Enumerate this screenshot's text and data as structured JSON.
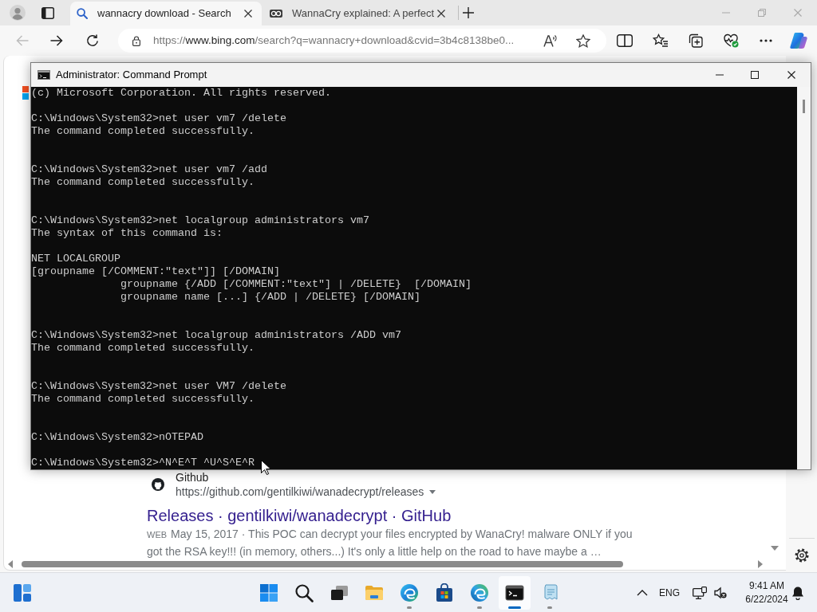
{
  "browser": {
    "tabs": [
      {
        "kind": "search",
        "title": "wannacry download - Search",
        "selected": true
      },
      {
        "kind": "site",
        "title": "WannaCry explained: A perfect",
        "selected": false
      }
    ],
    "nav": [
      {
        "kind": "back",
        "disabled": true
      },
      {
        "kind": "forward",
        "disabled": false
      },
      {
        "kind": "refresh",
        "disabled": false
      }
    ],
    "address": {
      "scheme": "https://",
      "host": "www.bing.com",
      "path": "/search?q=wannacry+download&cvid=3b4c8138be0..."
    }
  },
  "console": {
    "title": "Administrator: Command Prompt",
    "lines": [
      {
        "kind": "text",
        "text": "(c) Microsoft Corporation. All rights reserved."
      },
      {
        "kind": "blank"
      },
      {
        "kind": "text",
        "text": "C:\\Windows\\System32>net user vm7 /delete"
      },
      {
        "kind": "text",
        "text": "The command completed successfully."
      },
      {
        "kind": "blank"
      },
      {
        "kind": "blank"
      },
      {
        "kind": "text",
        "text": "C:\\Windows\\System32>net user vm7 /add"
      },
      {
        "kind": "text",
        "text": "The command completed successfully."
      },
      {
        "kind": "blank"
      },
      {
        "kind": "blank"
      },
      {
        "kind": "text",
        "text": "C:\\Windows\\System32>net localgroup administrators vm7"
      },
      {
        "kind": "text",
        "text": "The syntax of this command is:"
      },
      {
        "kind": "blank"
      },
      {
        "kind": "text",
        "text": "NET LOCALGROUP"
      },
      {
        "kind": "text",
        "text": "[groupname [/COMMENT:\"text\"]] [/DOMAIN]"
      },
      {
        "kind": "text",
        "text": "              groupname {/ADD [/COMMENT:\"text\"] | /DELETE}  [/DOMAIN]"
      },
      {
        "kind": "text",
        "text": "              groupname name [...] {/ADD | /DELETE} [/DOMAIN]"
      },
      {
        "kind": "blank"
      },
      {
        "kind": "blank"
      },
      {
        "kind": "text",
        "text": "C:\\Windows\\System32>net localgroup administrators /ADD vm7"
      },
      {
        "kind": "text",
        "text": "The command completed successfully."
      },
      {
        "kind": "blank"
      },
      {
        "kind": "blank"
      },
      {
        "kind": "text",
        "text": "C:\\Windows\\System32>net user VM7 /delete"
      },
      {
        "kind": "text",
        "text": "The command completed successfully."
      },
      {
        "kind": "blank"
      },
      {
        "kind": "blank"
      },
      {
        "kind": "text",
        "text": "C:\\Windows\\System32>nOTEPAD"
      },
      {
        "kind": "blank"
      },
      {
        "kind": "text",
        "text": "C:\\Windows\\System32>^N^E^T ^U^S^E^R"
      }
    ]
  },
  "search_result": {
    "source": "Github",
    "url": "https://github.com/gentilkiwi/wanadecrypt/releases",
    "title": "Releases · gentilkiwi/wanadecrypt · GitHub",
    "tag": "WEB",
    "snippet": "May 15, 2017 · This POC can decrypt your files encrypted by WanaCry! malware ONLY if you got the RSA key!!! (in memory, others...) It's only a little help on the road to have maybe a …"
  },
  "taskbar": {
    "apps": [
      {
        "kind": "explorer",
        "running": false,
        "selected": false
      },
      {
        "kind": "edge",
        "running": true,
        "selected": false
      },
      {
        "kind": "store",
        "running": false,
        "selected": false
      },
      {
        "kind": "edge-dev",
        "running": true,
        "selected": false
      },
      {
        "kind": "terminal",
        "running": true,
        "selected": true
      },
      {
        "kind": "notepad",
        "running": true,
        "selected": false
      }
    ],
    "language": "ENG",
    "time": "9:41 AM",
    "date": "6/22/2024"
  }
}
